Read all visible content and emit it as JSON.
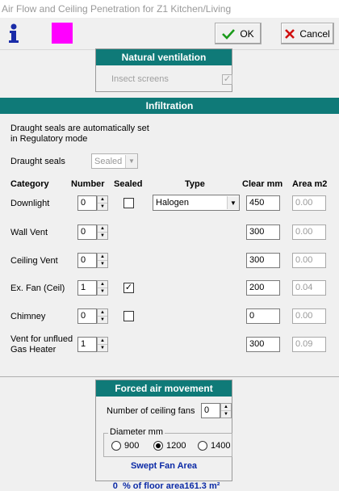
{
  "window": {
    "title": "Air Flow and Ceiling Penetration for Z1  Kitchen/Living"
  },
  "toolbar": {
    "ok_label": "OK",
    "cancel_label": "Cancel",
    "zone_color": "#ff00ff"
  },
  "natural_ventilation": {
    "header": "Natural ventilation",
    "insect_screens_label": "Insect screens",
    "insect_screens_checked": true
  },
  "infiltration": {
    "header": "Infiltration",
    "note_line1": "Draught seals are automatically set",
    "note_line2": "in Regulatory mode",
    "draught_seals_label": "Draught seals",
    "draught_seals_value": "Sealed",
    "columns": {
      "category": "Category",
      "number": "Number",
      "sealed": "Sealed",
      "type": "Type",
      "clear": "Clear mm",
      "area": "Area m2"
    },
    "rows": [
      {
        "label": "Downlight",
        "number": "0",
        "sealed": "unchecked",
        "type": "Halogen",
        "clear": "450",
        "area": "0.00"
      },
      {
        "label": "Wall  Vent",
        "number": "0",
        "sealed": "none",
        "type": "",
        "clear": "300",
        "area": "0.00"
      },
      {
        "label": "Ceiling Vent",
        "number": "0",
        "sealed": "none",
        "type": "",
        "clear": "300",
        "area": "0.00"
      },
      {
        "label": "Ex. Fan (Ceil)",
        "number": "1",
        "sealed": "checked",
        "type": "",
        "clear": "200",
        "area": "0.04"
      },
      {
        "label": "Chimney",
        "number": "0",
        "sealed": "unchecked",
        "type": "",
        "clear": "0",
        "area": "0.00"
      },
      {
        "label": "Vent for unflued",
        "label2": "Gas Heater",
        "number": "1",
        "sealed": "none",
        "type": "",
        "clear": "300",
        "area": "0.09"
      }
    ]
  },
  "forced_air": {
    "header": "Forced air movement",
    "ceiling_fans_label": "Number of ceiling fans",
    "ceiling_fans_value": "0",
    "diameter_label": "Diameter  mm",
    "diameter_options": [
      "900",
      "1200",
      "1400"
    ],
    "diameter_selected": "1200",
    "swept_label": "Swept Fan Area",
    "swept_value": "0",
    "swept_suffix": "  % of floor area161.3 m²"
  }
}
